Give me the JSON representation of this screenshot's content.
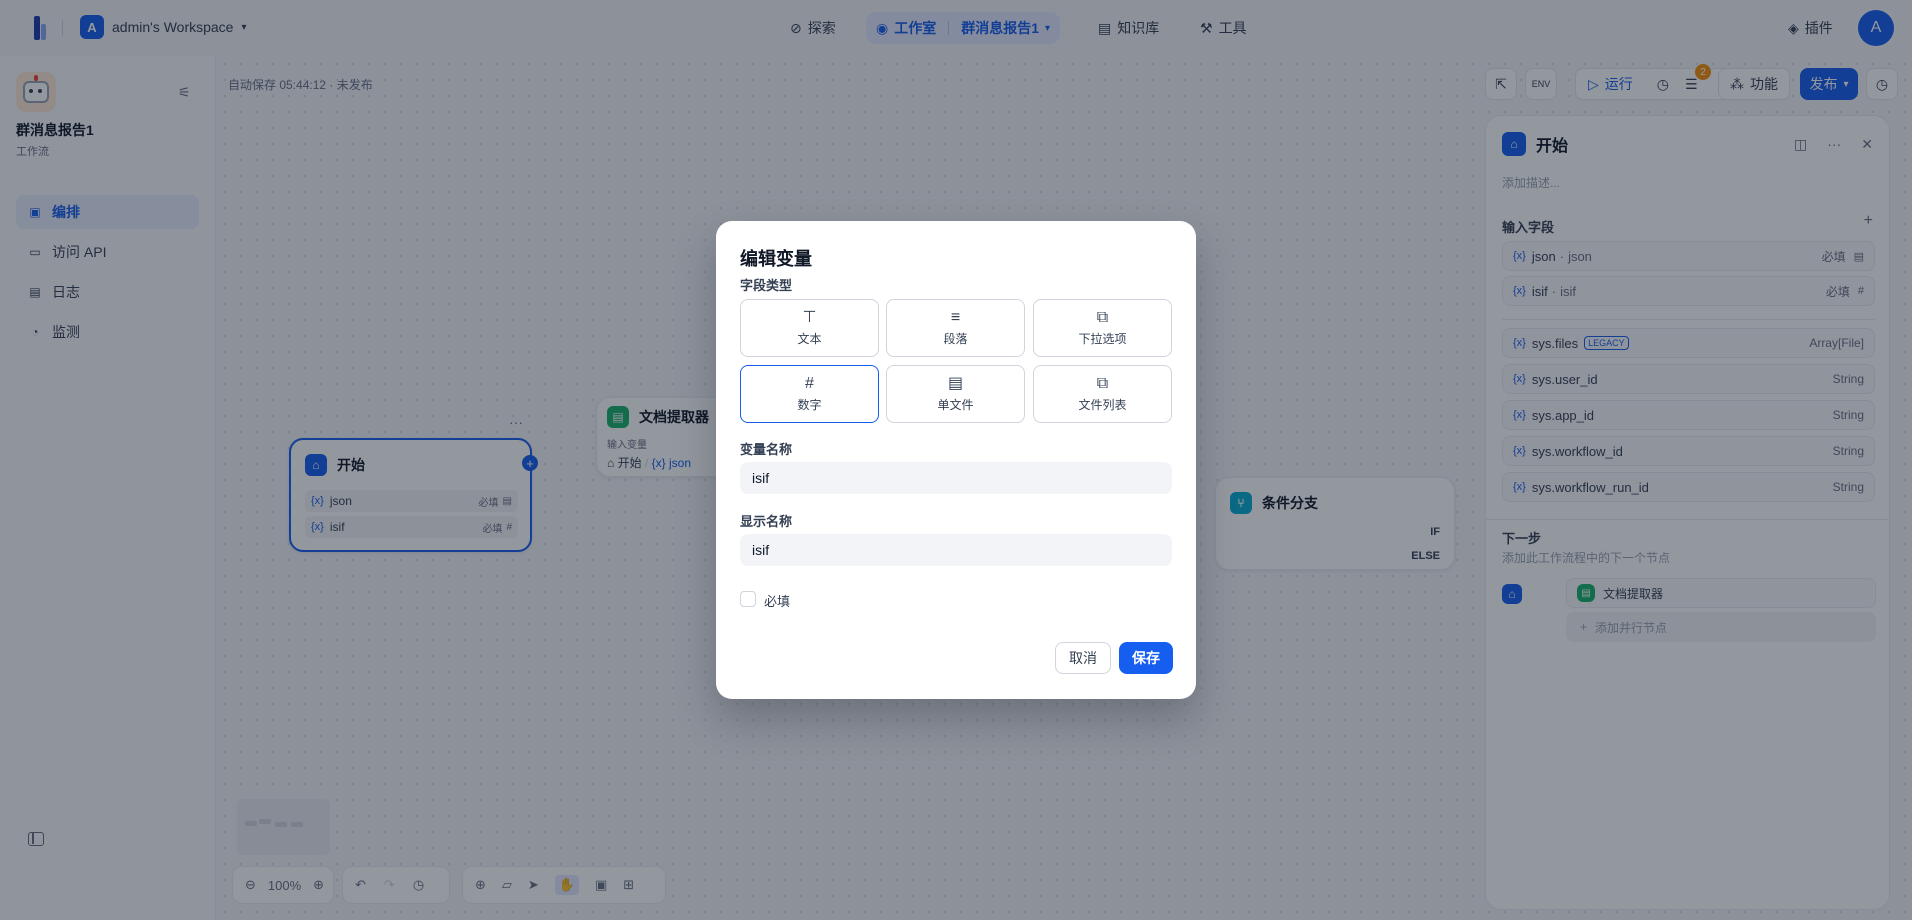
{
  "topbar": {
    "workspace_initial": "A",
    "workspace_name": "admin's Workspace",
    "nav": {
      "explore": "探索",
      "studio": "工作室",
      "app": "群消息报告1",
      "knowledge": "知识库",
      "tools": "工具"
    },
    "plugin": "插件",
    "avatar": "A"
  },
  "sidebar": {
    "app_name": "群消息报告1",
    "app_type": "工作流",
    "items": [
      {
        "label": "编排",
        "icon": "layout-icon"
      },
      {
        "label": "访问 API",
        "icon": "terminal-icon"
      },
      {
        "label": "日志",
        "icon": "file-icon"
      },
      {
        "label": "监测",
        "icon": "gauge-icon"
      }
    ]
  },
  "canvas": {
    "autosave": "自动保存 05:44:12 · 未发布",
    "toolbar": {
      "run": "运行",
      "badge": "2",
      "features": "功能",
      "publish": "发布"
    },
    "zoom": "100%",
    "nodes": {
      "start": {
        "title": "开始",
        "vars": [
          {
            "name": "json",
            "req": "必填"
          },
          {
            "name": "isif",
            "req": "必填"
          }
        ]
      },
      "extract": {
        "title": "文档提取器",
        "input_label": "输入变量",
        "input_source": "开始",
        "input_var": "json"
      },
      "branch": {
        "title": "条件分支",
        "if": "IF",
        "else": "ELSE"
      }
    }
  },
  "panel": {
    "title": "开始",
    "desc_placeholder": "添加描述...",
    "input_fields_title": "输入字段",
    "fields": [
      {
        "name": "json",
        "label": "json",
        "req": "必填"
      },
      {
        "name": "isif",
        "label": "isif",
        "req": "必填"
      }
    ],
    "sys_fields": [
      {
        "name": "sys.files",
        "tag": "LEGACY",
        "type": "Array[File]"
      },
      {
        "name": "sys.user_id",
        "type": "String"
      },
      {
        "name": "sys.app_id",
        "type": "String"
      },
      {
        "name": "sys.workflow_id",
        "type": "String"
      },
      {
        "name": "sys.workflow_run_id",
        "type": "String"
      }
    ],
    "next_title": "下一步",
    "next_desc": "添加此工作流程中的下一个节点",
    "next_node": "文档提取器",
    "add_parallel": "添加并行节点"
  },
  "modal": {
    "title": "编辑变量",
    "field_type_label": "字段类型",
    "types": [
      {
        "label": "文本",
        "icon": "text-icon"
      },
      {
        "label": "段落",
        "icon": "paragraph-icon"
      },
      {
        "label": "下拉选项",
        "icon": "select-icon"
      },
      {
        "label": "数字",
        "icon": "hash-icon"
      },
      {
        "label": "单文件",
        "icon": "file-icon"
      },
      {
        "label": "文件列表",
        "icon": "files-icon"
      }
    ],
    "selected_type": "数字",
    "var_name_label": "变量名称",
    "var_name_value": "isif",
    "display_name_label": "显示名称",
    "display_name_value": "isif",
    "required_label": "必填",
    "cancel": "取消",
    "save": "保存"
  }
}
